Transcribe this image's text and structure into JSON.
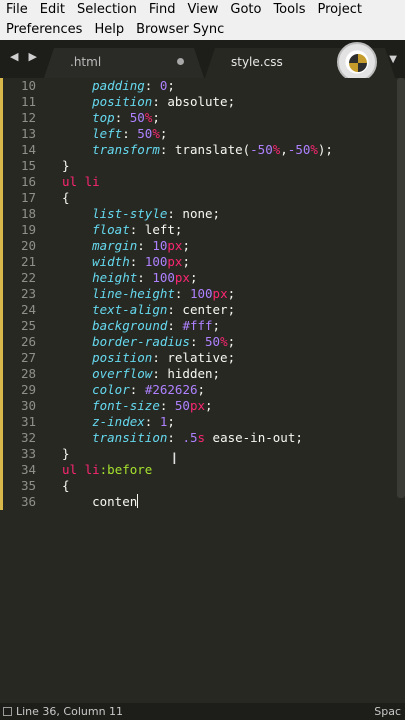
{
  "menu": {
    "row1": [
      "File",
      "Edit",
      "Selection",
      "Find",
      "View",
      "Goto",
      "Tools",
      "Project"
    ],
    "row2": [
      "Preferences",
      "Help",
      "Browser Sync"
    ]
  },
  "tabs": [
    {
      "label": ".html",
      "active": false
    },
    {
      "label": "style.css",
      "active": true
    }
  ],
  "icons": {
    "back": "◀",
    "forward": "▶",
    "dropdown": "▼"
  },
  "colors": {
    "background": "#272822",
    "property": "#66d9ef",
    "number": "#ae81ff",
    "unit_selector": "#f92672",
    "pseudo": "#a6e22e",
    "text": "#f8f8f2",
    "line_number": "#8f908a"
  },
  "editor": {
    "lines": [
      {
        "n": "10",
        "indent": "    ",
        "tokens": [
          [
            "prop",
            "padding"
          ],
          [
            "val",
            ": "
          ],
          [
            "num",
            "0"
          ],
          [
            "val",
            ";"
          ]
        ]
      },
      {
        "n": "11",
        "indent": "    ",
        "tokens": [
          [
            "prop",
            "position"
          ],
          [
            "val",
            ": absolute;"
          ]
        ]
      },
      {
        "n": "12",
        "indent": "    ",
        "tokens": [
          [
            "prop",
            "top"
          ],
          [
            "val",
            ": "
          ],
          [
            "num",
            "50"
          ],
          [
            "unit",
            "%"
          ],
          [
            "val",
            ";"
          ]
        ]
      },
      {
        "n": "13",
        "indent": "    ",
        "tokens": [
          [
            "prop",
            "left"
          ],
          [
            "val",
            ": "
          ],
          [
            "num",
            "50"
          ],
          [
            "unit",
            "%"
          ],
          [
            "val",
            ";"
          ]
        ]
      },
      {
        "n": "14",
        "indent": "    ",
        "tokens": [
          [
            "prop",
            "transform"
          ],
          [
            "val",
            ": translate("
          ],
          [
            "num",
            "-50"
          ],
          [
            "unit",
            "%"
          ],
          [
            "val",
            ","
          ],
          [
            "num",
            "-50"
          ],
          [
            "unit",
            "%"
          ],
          [
            "val",
            ");"
          ]
        ]
      },
      {
        "n": "15",
        "indent": "",
        "tokens": [
          [
            "brace",
            "}"
          ]
        ]
      },
      {
        "n": "16",
        "indent": "",
        "tokens": [
          [
            "sel",
            "ul li"
          ]
        ]
      },
      {
        "n": "17",
        "indent": "",
        "tokens": [
          [
            "brace",
            "{"
          ]
        ]
      },
      {
        "n": "18",
        "indent": "    ",
        "tokens": [
          [
            "prop",
            "list-style"
          ],
          [
            "val",
            ": none;"
          ]
        ]
      },
      {
        "n": "19",
        "indent": "    ",
        "tokens": [
          [
            "prop",
            "float"
          ],
          [
            "val",
            ": left;"
          ]
        ]
      },
      {
        "n": "20",
        "indent": "    ",
        "tokens": [
          [
            "prop",
            "margin"
          ],
          [
            "val",
            ": "
          ],
          [
            "num",
            "10"
          ],
          [
            "unit",
            "px"
          ],
          [
            "val",
            ";"
          ]
        ]
      },
      {
        "n": "21",
        "indent": "    ",
        "tokens": [
          [
            "prop",
            "width"
          ],
          [
            "val",
            ": "
          ],
          [
            "num",
            "100"
          ],
          [
            "unit",
            "px"
          ],
          [
            "val",
            ";"
          ]
        ]
      },
      {
        "n": "22",
        "indent": "    ",
        "tokens": [
          [
            "prop",
            "height"
          ],
          [
            "val",
            ": "
          ],
          [
            "num",
            "100"
          ],
          [
            "unit",
            "px"
          ],
          [
            "val",
            ";"
          ]
        ]
      },
      {
        "n": "23",
        "indent": "    ",
        "tokens": [
          [
            "prop",
            "line-height"
          ],
          [
            "val",
            ": "
          ],
          [
            "num",
            "100"
          ],
          [
            "unit",
            "px"
          ],
          [
            "val",
            ";"
          ]
        ]
      },
      {
        "n": "24",
        "indent": "    ",
        "tokens": [
          [
            "prop",
            "text-align"
          ],
          [
            "val",
            ": center;"
          ]
        ]
      },
      {
        "n": "25",
        "indent": "    ",
        "tokens": [
          [
            "prop",
            "background"
          ],
          [
            "val",
            ": "
          ],
          [
            "num",
            "#fff"
          ],
          [
            "val",
            ";"
          ]
        ]
      },
      {
        "n": "26",
        "indent": "    ",
        "tokens": [
          [
            "prop",
            "border-radius"
          ],
          [
            "val",
            ": "
          ],
          [
            "num",
            "50"
          ],
          [
            "unit",
            "%"
          ],
          [
            "val",
            ";"
          ]
        ]
      },
      {
        "n": "27",
        "indent": "    ",
        "tokens": [
          [
            "prop",
            "position"
          ],
          [
            "val",
            ": relative;"
          ]
        ]
      },
      {
        "n": "28",
        "indent": "    ",
        "tokens": [
          [
            "prop",
            "overflow"
          ],
          [
            "val",
            ": hidden;"
          ]
        ]
      },
      {
        "n": "29",
        "indent": "    ",
        "tokens": [
          [
            "prop",
            "color"
          ],
          [
            "val",
            ": "
          ],
          [
            "num",
            "#262626"
          ],
          [
            "val",
            ";"
          ]
        ]
      },
      {
        "n": "30",
        "indent": "    ",
        "tokens": [
          [
            "prop",
            "font-size"
          ],
          [
            "val",
            ": "
          ],
          [
            "num",
            "50"
          ],
          [
            "unit",
            "px"
          ],
          [
            "val",
            ";"
          ]
        ]
      },
      {
        "n": "31",
        "indent": "    ",
        "tokens": [
          [
            "prop",
            "z-index"
          ],
          [
            "val",
            ": "
          ],
          [
            "num",
            "1"
          ],
          [
            "val",
            ";"
          ]
        ]
      },
      {
        "n": "32",
        "indent": "    ",
        "tokens": [
          [
            "prop",
            "transition"
          ],
          [
            "val",
            ": "
          ],
          [
            "num",
            ".5"
          ],
          [
            "unit",
            "s"
          ],
          [
            "val",
            " ease-in-out;"
          ]
        ]
      },
      {
        "n": "33",
        "indent": "",
        "tokens": [
          [
            "brace",
            "}"
          ]
        ]
      },
      {
        "n": "34",
        "indent": "",
        "tokens": [
          [
            "sel",
            "ul li"
          ],
          [
            "pseudo",
            ":before"
          ]
        ]
      },
      {
        "n": "35",
        "indent": "",
        "tokens": [
          [
            "brace",
            "{"
          ]
        ]
      },
      {
        "n": "36",
        "indent": "    ",
        "tokens": [
          [
            "val",
            "conten"
          ]
        ],
        "cursor": true
      }
    ]
  },
  "status": {
    "position": "Line 36, Column 11",
    "right": "Spac"
  }
}
